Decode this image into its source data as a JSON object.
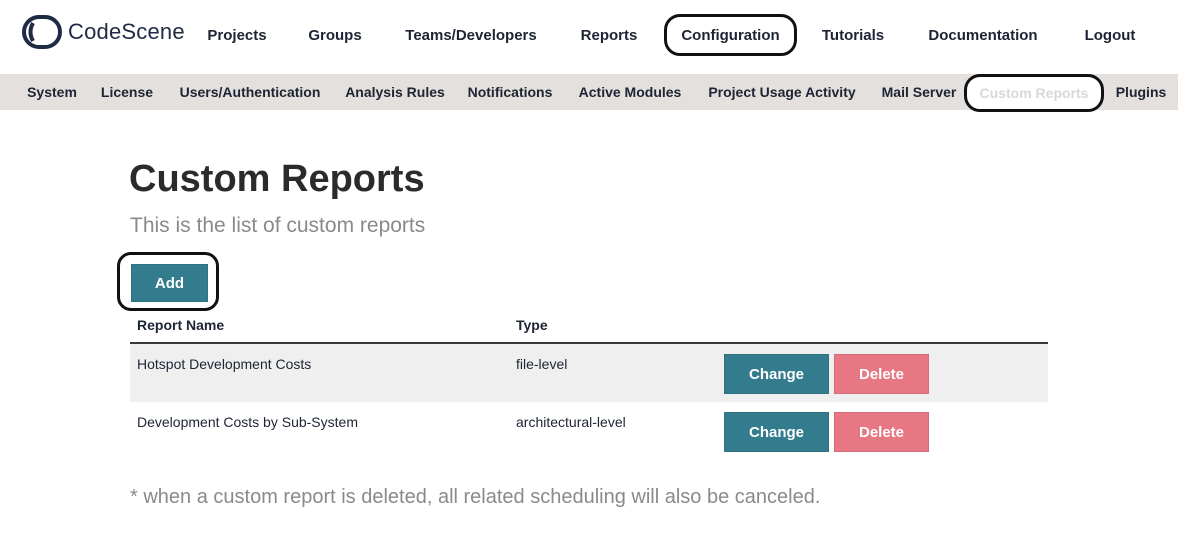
{
  "brand": {
    "name": "CodeScene",
    "logo_icon": "codescene-logo-icon"
  },
  "topnav": {
    "items": [
      {
        "label": "Projects"
      },
      {
        "label": "Groups"
      },
      {
        "label": "Teams/Developers"
      },
      {
        "label": "Reports"
      },
      {
        "label": "Configuration",
        "active": true
      },
      {
        "label": "Tutorials"
      },
      {
        "label": "Documentation"
      },
      {
        "label": "Logout"
      }
    ]
  },
  "subnav": {
    "items": [
      {
        "label": "System"
      },
      {
        "label": "License"
      },
      {
        "label": "Users/Authentication"
      },
      {
        "label": "Analysis Rules"
      },
      {
        "label": "Notifications"
      },
      {
        "label": "Active Modules"
      },
      {
        "label": "Project Usage Activity"
      },
      {
        "label": "Mail Server"
      },
      {
        "label": "Custom Reports",
        "active": true
      },
      {
        "label": "Plugins"
      }
    ]
  },
  "page": {
    "title": "Custom Reports",
    "subtitle": "This is the list of custom reports",
    "add_label": "Add",
    "footnote": "* when a custom report is deleted, all related scheduling will also be canceled."
  },
  "table": {
    "columns": [
      "Report Name",
      "Type"
    ],
    "rows": [
      {
        "name": "Hotspot Development Costs",
        "type": "file-level",
        "change_label": "Change",
        "delete_label": "Delete"
      },
      {
        "name": "Development Costs by Sub-System",
        "type": "architectural-level",
        "change_label": "Change",
        "delete_label": "Delete"
      }
    ]
  },
  "colors": {
    "primary": "#327c8e",
    "danger": "#e67783",
    "subnav_bg": "#e4e0dd",
    "row_shade": "#efefef"
  }
}
